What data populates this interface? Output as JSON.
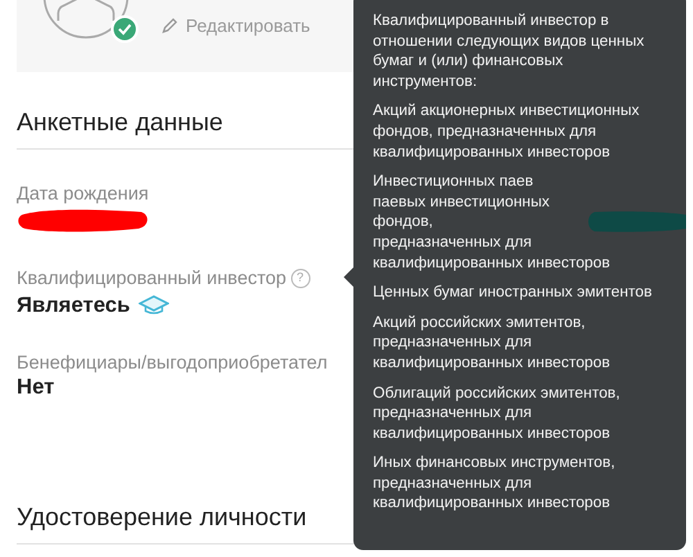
{
  "profile_card": {
    "verified": true,
    "edit_label": "Редактировать"
  },
  "questionnaire": {
    "title": "Анкетные данные",
    "fields": [
      {
        "label": "Дата рождения",
        "kind": "redacted"
      },
      {
        "label": "Квалифицированный инвестор",
        "kind": "status",
        "help": "?",
        "value": "Являетесь"
      },
      {
        "label": "Бенефициары/выгодоприобретател",
        "kind": "text",
        "value": "Нет"
      }
    ]
  },
  "next_section": {
    "title": "Удостоверение личности"
  },
  "tooltip": {
    "paragraphs": [
      {
        "kind": "plain",
        "text": "Квалифицированный инвестор в отношении следующих видов ценных бумаг и (или) финансовых инструментов:"
      },
      {
        "kind": "plain",
        "text": "Акций акционерных инвестиционных фондов, предназначенных для квалифицированных инвесторов"
      },
      {
        "kind": "redacted",
        "text": "Инвестиционных паев паевых инвестиционных фондов,",
        "after": "предназначенных для квалифицированных инвесторов"
      },
      {
        "kind": "plain",
        "text": "Ценных бумаг иностранных эмитентов"
      },
      {
        "kind": "plain",
        "text": "Акций российских эмитентов, предназначенных для квалифицированных инвесторов"
      },
      {
        "kind": "plain",
        "text": "Облигаций российских эмитентов, предназначенных для квалифицированных инвесторов"
      },
      {
        "kind": "plain",
        "text": "Иных финансовых инструментов, предназначенных для квалифицированных инвесторов"
      }
    ]
  }
}
